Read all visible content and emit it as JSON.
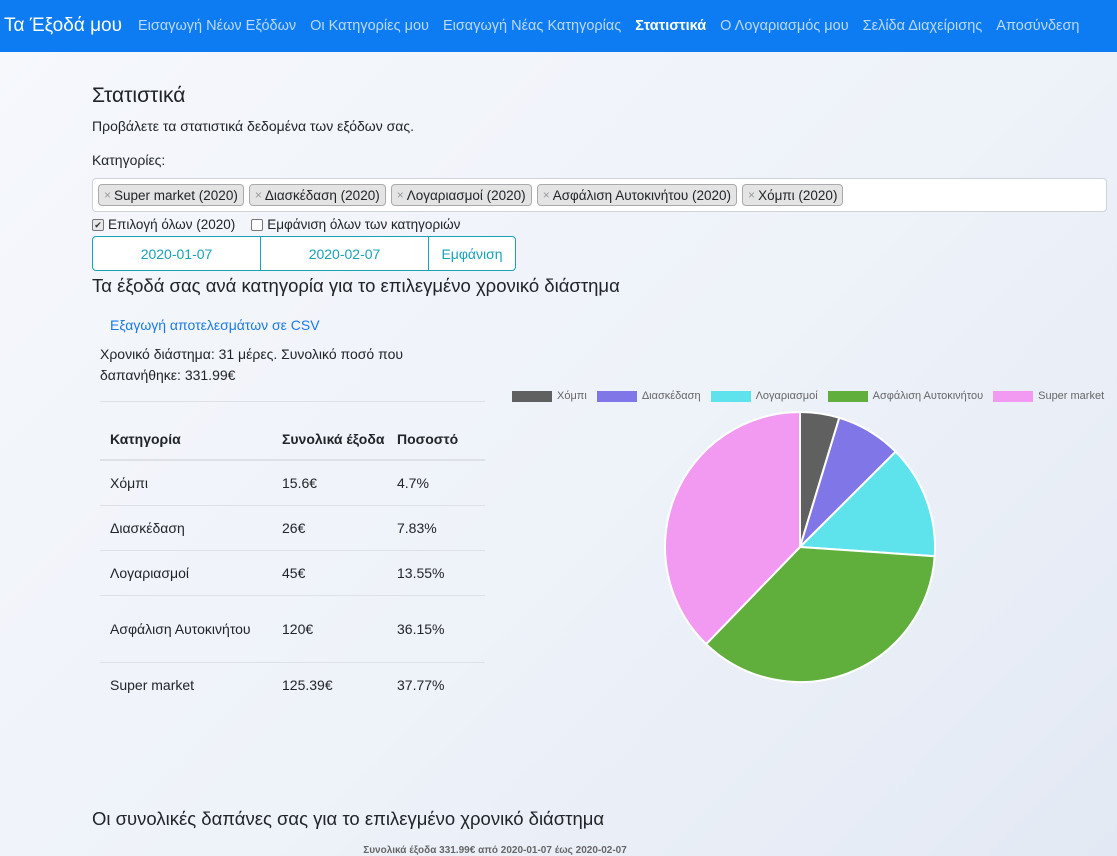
{
  "nav": {
    "brand": "Τα Έξοδά μου",
    "links": [
      {
        "label": "Εισαγωγή Νέων Εξόδων",
        "active": false
      },
      {
        "label": "Οι Κατηγορίες μου",
        "active": false
      },
      {
        "label": "Εισαγωγή Νέας Κατηγορίας",
        "active": false
      },
      {
        "label": "Στατιστικά",
        "active": true
      },
      {
        "label": "Ο Λογαριασμός μου",
        "active": false
      },
      {
        "label": "Σελίδα Διαχείρισης",
        "active": false
      },
      {
        "label": "Αποσύνδεση",
        "active": false
      }
    ]
  },
  "page": {
    "title": "Στατιστικά",
    "subtitle": "Προβάλετε τα στατιστικά δεδομένα των εξόδων σας.",
    "categories_label": "Κατηγορίες:"
  },
  "filters": {
    "tags": [
      "Super market (2020)",
      "Διασκέδαση (2020)",
      "Λογαριασμοί (2020)",
      "Ασφάλιση Αυτοκινήτου (2020)",
      "Χόμπι (2020)"
    ],
    "tag_remove_symbol": "×",
    "select_all_label": "Επιλογή όλων (2020)",
    "select_all_checked": true,
    "show_all_label": "Εμφάνιση όλων των κατηγοριών",
    "show_all_checked": false,
    "check_mark": "✔",
    "date_from": "2020-01-07",
    "date_to": "2020-02-07",
    "show_button": "Εμφάνιση"
  },
  "section1": {
    "title": "Τα έξοδά σας ανά κατηγορία για το επιλεγμένο χρονικό διάστημα",
    "csv_link": "Εξαγωγή αποτελεσμάτων σε CSV",
    "period_text": "Χρονικό διάστημα: 31 μέρες. Συνολικό ποσό που δαπανήθηκε: 331.99€"
  },
  "table": {
    "headers": [
      "Κατηγορία",
      "Συνολικά έξοδα",
      "Ποσοστό"
    ],
    "rows": [
      [
        "Χόμπι",
        "15.6€",
        "4.7%"
      ],
      [
        "Διασκέδαση",
        "26€",
        "7.83%"
      ],
      [
        "Λογαριασμοί",
        "45€",
        "13.55%"
      ],
      [
        "Ασφάλιση Αυτοκινήτου",
        "120€",
        "36.15%"
      ],
      [
        "Super market",
        "125.39€",
        "37.77%"
      ]
    ]
  },
  "chart_data": {
    "type": "pie",
    "legend_position": "top",
    "categories": [
      "Χόμπι",
      "Διασκέδαση",
      "Λογαριασμοί",
      "Ασφάλιση Αυτοκινήτου",
      "Super market"
    ],
    "values": [
      15.6,
      26,
      45,
      120,
      125.39
    ],
    "colors": [
      "#606060",
      "#8076e8",
      "#5ee3ed",
      "#60af3c",
      "#f29af2"
    ]
  },
  "section2": {
    "title": "Οι συνολικές δαπάνες σας για το επιλεγμένο χρονικό διάστημα",
    "chart_title": "Συνολικά έξοδα 331.99€ από 2020-01-07 έως 2020-02-07"
  },
  "colors": {
    "navbar": "#0d7cf2",
    "accent_info": "#17a2b8",
    "link": "#1a7ae8"
  }
}
